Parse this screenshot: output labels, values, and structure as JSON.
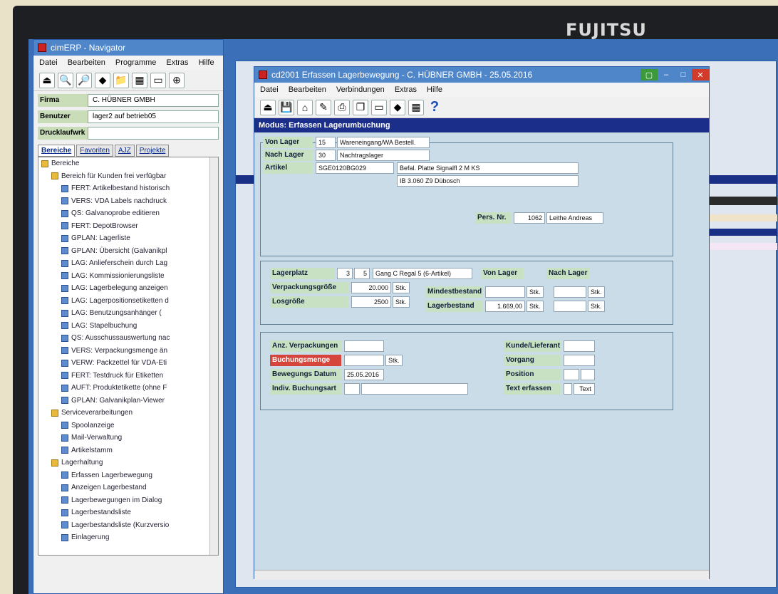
{
  "monitor": {
    "brand": "FUJITSU"
  },
  "navigator": {
    "title": "cimERP - Navigator",
    "menu": [
      "Datei",
      "Bearbeiten",
      "Programme",
      "Extras",
      "Hilfe"
    ],
    "fields": [
      {
        "label": "Firma",
        "value": "C. HÜBNER GMBH"
      },
      {
        "label": "Benutzer",
        "value": "lager2 auf betrieb05"
      },
      {
        "label": "Drucklaufwrk",
        "value": ""
      }
    ],
    "tabs": [
      "Bereiche",
      "Favoriten",
      "AJZ",
      "Projekte"
    ],
    "tree": [
      {
        "label": "Bereiche",
        "level": 0,
        "type": "folder"
      },
      {
        "label": "Bereich für Kunden frei verfügbar",
        "level": 1,
        "type": "folder"
      },
      {
        "label": "FERT: Artikelbestand historisch",
        "level": 2,
        "type": "doc"
      },
      {
        "label": "VERS: VDA Labels nachdruck",
        "level": 2,
        "type": "doc"
      },
      {
        "label": "QS: Galvanoprobe editieren",
        "level": 2,
        "type": "doc"
      },
      {
        "label": "FERT: DepotBrowser",
        "level": 2,
        "type": "doc"
      },
      {
        "label": "GPLAN: Lagerliste",
        "level": 2,
        "type": "doc"
      },
      {
        "label": "GPLAN: Übersicht (Galvanikpl",
        "level": 2,
        "type": "doc"
      },
      {
        "label": "LAG: Anlieferschein durch Lag",
        "level": 2,
        "type": "doc"
      },
      {
        "label": "LAG: Kommissionierungsliste",
        "level": 2,
        "type": "doc"
      },
      {
        "label": "LAG: Lagerbelegung anzeigen",
        "level": 2,
        "type": "doc"
      },
      {
        "label": "LAG: Lagerpositionsetiketten d",
        "level": 2,
        "type": "doc"
      },
      {
        "label": "LAG: Benutzungsanhänger (",
        "level": 2,
        "type": "doc"
      },
      {
        "label": "LAG: Stapelbuchung",
        "level": 2,
        "type": "doc"
      },
      {
        "label": "QS: Ausschussauswertung nac",
        "level": 2,
        "type": "doc"
      },
      {
        "label": "VERS: Verpackungsmenge än",
        "level": 2,
        "type": "doc"
      },
      {
        "label": "VERW: Packzettel für VDA-Eti",
        "level": 2,
        "type": "doc"
      },
      {
        "label": "FERT: Testdruck für Etiketten",
        "level": 2,
        "type": "doc"
      },
      {
        "label": "AUFT: Produktetikette (ohne F",
        "level": 2,
        "type": "doc"
      },
      {
        "label": "GPLAN: Galvanikplan-Viewer",
        "level": 2,
        "type": "doc"
      },
      {
        "label": "Serviceverarbeitungen",
        "level": 1,
        "type": "folder"
      },
      {
        "label": "Spoolanzeige",
        "level": 2,
        "type": "doc"
      },
      {
        "label": "Mail-Verwaltung",
        "level": 2,
        "type": "doc"
      },
      {
        "label": "Artikelstamm",
        "level": 2,
        "type": "doc"
      },
      {
        "label": "Lagerhaltung",
        "level": 1,
        "type": "folder"
      },
      {
        "label": "Erfassen Lagerbewegung",
        "level": 2,
        "type": "doc"
      },
      {
        "label": "Anzeigen Lagerbestand",
        "level": 2,
        "type": "doc"
      },
      {
        "label": "Lagerbewegungen im Dialog",
        "level": 2,
        "type": "doc"
      },
      {
        "label": "Lagerbestandsliste",
        "level": 2,
        "type": "doc"
      },
      {
        "label": "Lagerbestandsliste (Kurzversio",
        "level": 2,
        "type": "doc"
      },
      {
        "label": "Einlagerung",
        "level": 2,
        "type": "doc"
      }
    ]
  },
  "main": {
    "title": "cd2001 Erfassen Lagerbewegung - C. HÜBNER GMBH - 25.05.2016",
    "menu": [
      "Datei",
      "Bearbeiten",
      "Verbindungen",
      "Extras",
      "Hilfe"
    ],
    "mode": "Modus: Erfassen Lagerumbuchung",
    "von_lager": {
      "label": "Von Lager",
      "code": "15",
      "name": "Wareneingang/WA Bestell."
    },
    "nach_lager": {
      "label": "Nach Lager",
      "code": "30",
      "name": "Nachtragslager"
    },
    "artikel": {
      "label": "Artikel",
      "value": "SGE0120BG029",
      "desc1": "Befal. Platte Signalfl 2 M KS",
      "desc2": "IB 3.060 Z9 Dübosch"
    },
    "pers": {
      "label": "Pers. Nr.",
      "nr": "1062",
      "name": "Leithe Andreas"
    },
    "lagerplatz": {
      "label": "Lagerplatz",
      "a": "3",
      "b": "5",
      "text": "Gang C Regal 5 (6-Artikel)"
    },
    "col_von": "Von Lager",
    "col_nach": "Nach Lager",
    "verpackungsgroesse": {
      "label": "Verpackungsgröße",
      "value": "20.000",
      "unit": "Stk."
    },
    "losgroesse": {
      "label": "Losgröße",
      "value": "2500",
      "unit": "Stk."
    },
    "mindestbestand": {
      "label": "Mindestbestand",
      "unit1": "Stk.",
      "unit2": "Stk."
    },
    "lagerbestand": {
      "label": "Lagerbestand",
      "value": "1.669,00",
      "unit1": "Stk.",
      "unit2": "Stk."
    },
    "anz_verpackungen": {
      "label": "Anz. Verpackungen"
    },
    "buchungsmenge": {
      "label": "Buchungsmenge",
      "unit": "Stk."
    },
    "bewegungs_datum": {
      "label": "Bewegungs Datum",
      "value": "25.05.2016"
    },
    "indiv_buchungsart": {
      "label": "Indiv. Buchungsart"
    },
    "kunde": {
      "label": "Kunde/Lieferant"
    },
    "vorgang": {
      "label": "Vorgang"
    },
    "position": {
      "label": "Position"
    },
    "text_erfassen": {
      "label": "Text erfassen",
      "button": "Text"
    }
  }
}
